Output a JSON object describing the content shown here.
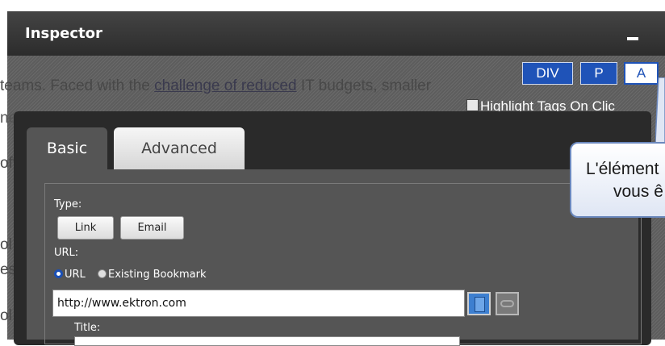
{
  "inspector": {
    "title": "Inspector",
    "minimize_glyph": "−"
  },
  "background_text": {
    "line1_before": "teams. Faced with the ",
    "line1_link": "challenge of reduced",
    "line1_after": " IT budgets, smaller",
    "line2": "ne                                 k        lk            f       l         ld              li",
    "fragments": [
      "off",
      "ol",
      "es",
      "ol"
    ]
  },
  "tag_buttons": [
    {
      "label": "DIV",
      "active": false
    },
    {
      "label": "P",
      "active": false
    },
    {
      "label": "A",
      "active": true
    }
  ],
  "highlight_label": "Highlight Tags On Clic",
  "tabs": [
    {
      "label": "Basic",
      "active": true
    },
    {
      "label": "Advanced",
      "active": false
    }
  ],
  "form": {
    "type_label": "Type:",
    "link_button": "Link",
    "email_button": "Email",
    "url_label": "URL:",
    "radio_url": "URL",
    "radio_bookmark": "Existing Bookmark",
    "url_value": "http://www.ektron.com",
    "title_label": "Title:"
  },
  "callout": {
    "line1": "L'élément",
    "line2": "vous ê"
  },
  "colors": {
    "accent": "#1f53b8",
    "titlebar": "#333333",
    "panel": "#555555"
  },
  "icons": [
    "bookmark-icon",
    "unlink-icon"
  ]
}
